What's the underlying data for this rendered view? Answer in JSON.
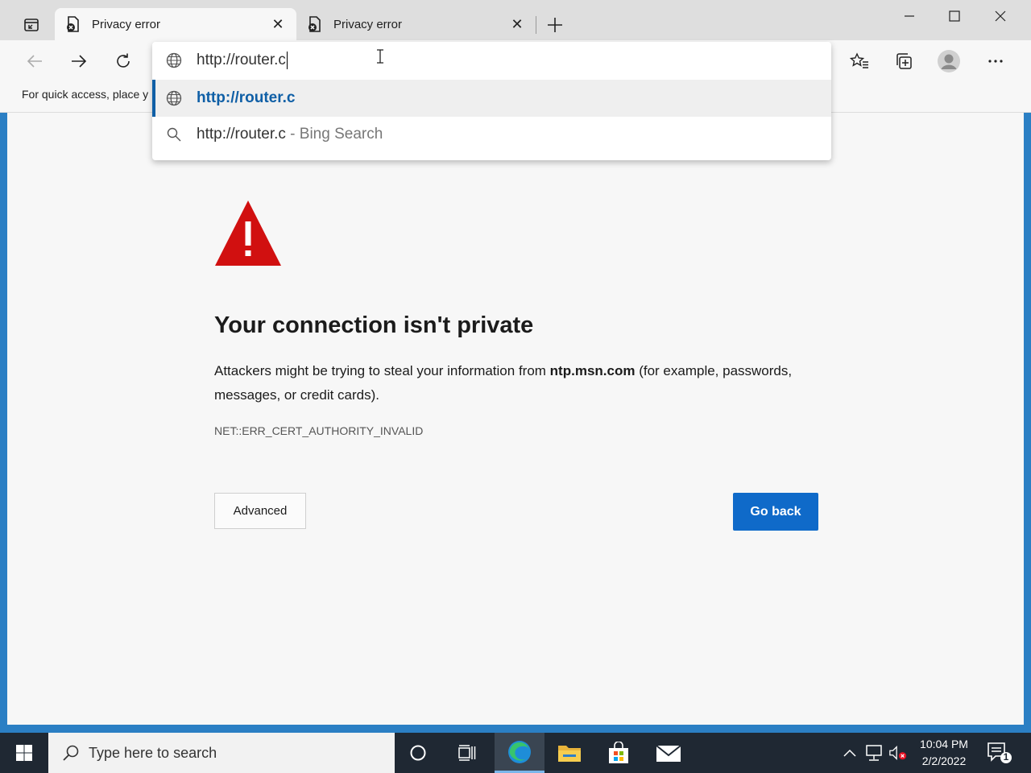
{
  "tabs": [
    {
      "title": "Privacy error",
      "active": true
    },
    {
      "title": "Privacy error",
      "active": false
    }
  ],
  "toolbar": {
    "back_label": "Back",
    "forward_label": "Forward",
    "refresh_label": "Refresh"
  },
  "favorites_bar": {
    "text": "For quick access, place y"
  },
  "omnibox": {
    "value": "http://router.c",
    "suggestions": [
      {
        "text": "http://router.c",
        "suffix": "",
        "icon": "globe-icon",
        "selected": true
      },
      {
        "text": "http://router.c",
        "suffix": " - Bing Search",
        "icon": "search-icon",
        "selected": false
      }
    ]
  },
  "page": {
    "heading": "Your connection isn't private",
    "desc_before": "Attackers might be trying to steal your information from ",
    "desc_domain": "ntp.msn.com",
    "desc_after": " (for example, passwords, messages, or credit cards).",
    "error_code": "NET::ERR_CERT_AUTHORITY_INVALID",
    "advanced_label": "Advanced",
    "go_back_label": "Go back"
  },
  "taskbar": {
    "search_placeholder": "Type here to search",
    "time": "10:04 PM",
    "date": "2/2/2022",
    "notification_count": "1"
  },
  "colors": {
    "accent": "#0f6ac9",
    "warning_red": "#d11010",
    "taskbar_bg": "#1f2833"
  }
}
